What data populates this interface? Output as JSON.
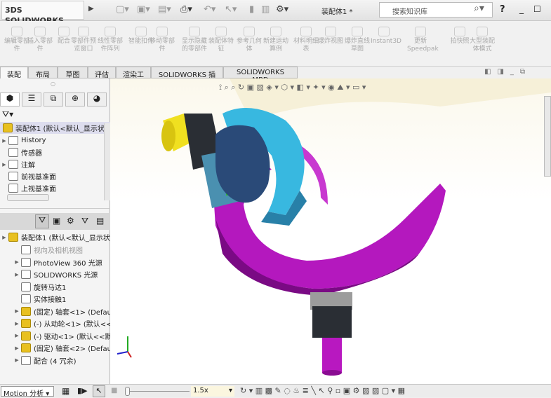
{
  "app": {
    "brand_prefix": "3DS",
    "brand": "SOLIDWORKS",
    "document_title": "装配体1 *",
    "search_placeholder": "搜索知识库",
    "help": "?"
  },
  "ribbon": {
    "items": [
      "编辑零部件",
      "插入零部件",
      "配合",
      "零部件预览窗口",
      "线性零部件阵列",
      "智能扣件",
      "移动零部件",
      "显示隐藏的零部件",
      "装配体特征",
      "参考几何体",
      "新建运动算例",
      "材料明细表",
      "爆炸视图",
      "爆炸直线草图",
      "Instant3D",
      "更新Speedpak",
      "拍快照",
      "大型装配体模式"
    ]
  },
  "tabs": [
    "装配体",
    "布局",
    "草图",
    "评估",
    "渲染工具",
    "SOLIDWORKS 插件",
    "SOLIDWORKS MBD"
  ],
  "feature_tree": {
    "root": "装配体1 (默认<默认_显示状态",
    "items": [
      "History",
      "传感器",
      "注解",
      "前视基准面",
      "上视基准面"
    ]
  },
  "motion_tree": {
    "root": "装配体1 (默认<默认_显示状",
    "items": [
      "视向及相机视图",
      "PhotoView 360 光源",
      "SOLIDWORKS 光源",
      "旋转马达1",
      "实体接触1",
      "(固定) 轴套<1> (Defau",
      "(-) 从动轮<1> (默认<<",
      "(-) 驱动<1> (默认<<默",
      "(固定) 轴套<2> (Defau",
      "配合 (4 冗余)"
    ]
  },
  "bottom": {
    "study_type": "Motion 分析",
    "playback_speed": "1.5x"
  },
  "colors": {
    "part_purple": "#c020c8",
    "part_blue": "#38b8e0",
    "part_yellow": "#f0e020",
    "part_green": "#30c030"
  }
}
